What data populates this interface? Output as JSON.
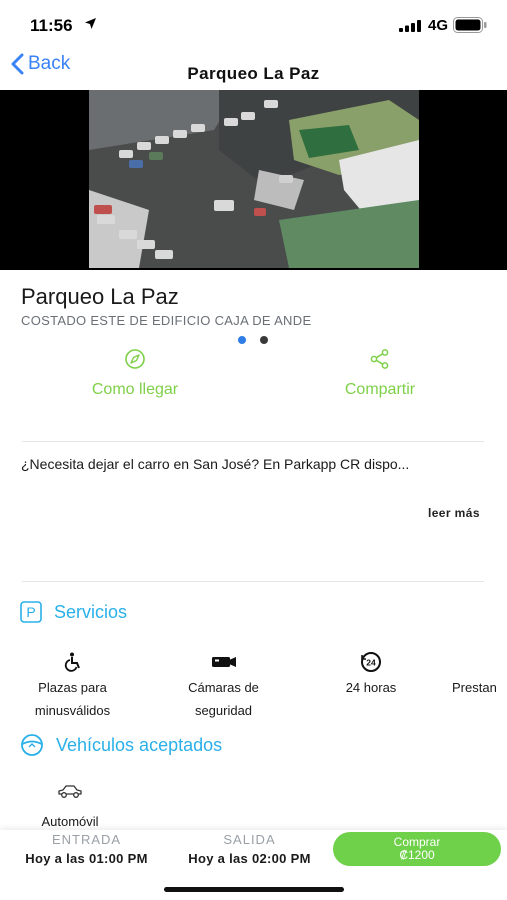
{
  "status_bar": {
    "time": "11:56",
    "network": "4G"
  },
  "nav": {
    "back_label": "Back",
    "title": "Parqueo La Paz"
  },
  "place": {
    "name": "Parqueo La Paz",
    "address": "COSTADO ESTE DE EDIFICIO CAJA DE ANDE"
  },
  "actions": {
    "directions": "Como llegar",
    "share": "Compartir"
  },
  "description": {
    "text": "¿Necesita dejar el carro en San José? En Parkapp CR dispo...",
    "read_more": "leer más"
  },
  "services": {
    "title": "Servicios",
    "items": [
      {
        "line1": "Plazas para",
        "line2": "minusválidos",
        "icon": "wheelchair-icon"
      },
      {
        "line1": "Cámaras de",
        "line2": "seguridad",
        "icon": "security-camera-icon"
      },
      {
        "line1": "24 horas",
        "line2": "",
        "icon": "24-hours-icon"
      },
      {
        "line1": "Prestan",
        "line2": "",
        "icon": ""
      }
    ]
  },
  "vehicles": {
    "title": "Vehículos  aceptados",
    "items": [
      {
        "label": "Automóvil",
        "icon": "car-icon"
      }
    ]
  },
  "footer": {
    "entry_label": "ENTRADA",
    "entry_value": "Hoy a las 01:00 PM",
    "exit_label": "SALIDA",
    "exit_value": "Hoy a las 02:00 PM",
    "buy_label": "Comprar",
    "price": "₡1200"
  },
  "colors": {
    "accent_green": "#7ed048",
    "accent_blue": "#2ab0e8",
    "ios_blue": "#3a82f7",
    "buy_button": "#6fd04a"
  }
}
